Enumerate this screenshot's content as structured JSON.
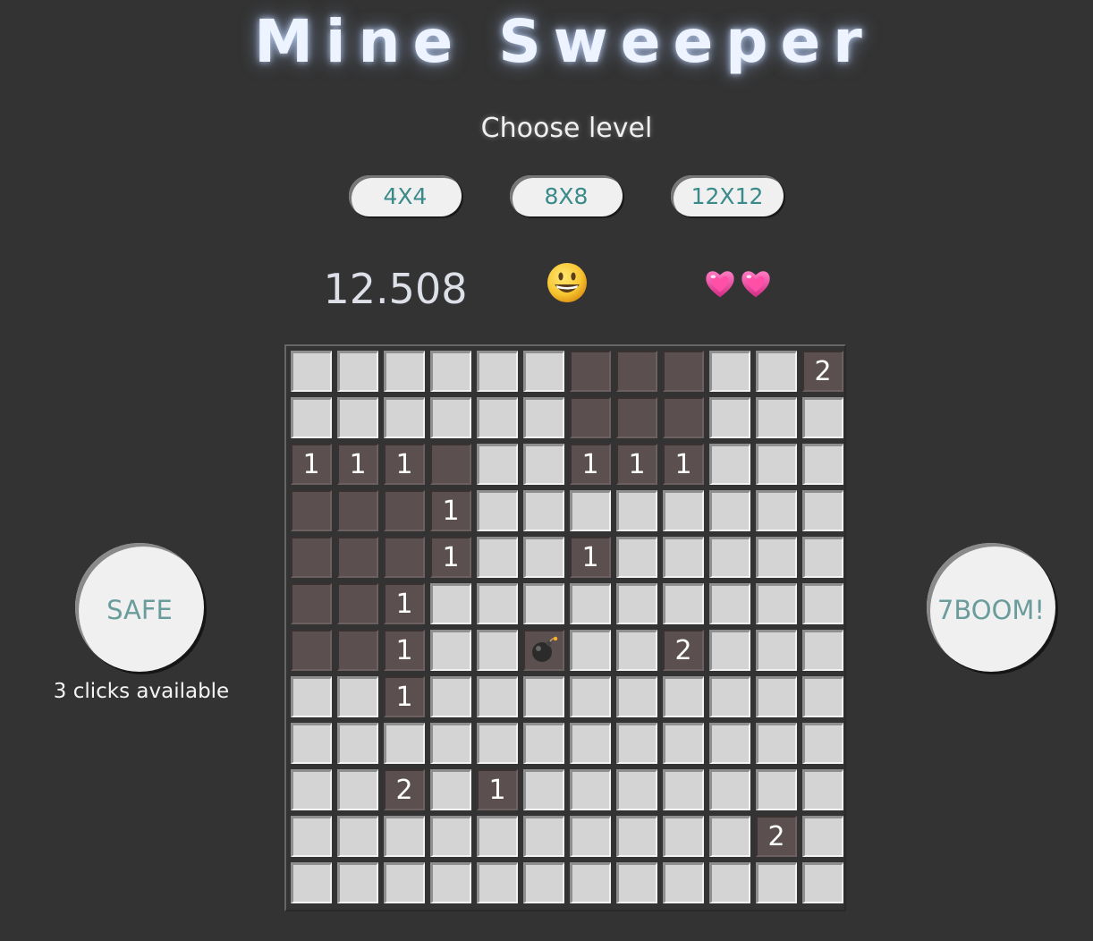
{
  "title": "Mine Sweeper",
  "subtitle": "Choose level",
  "levels": [
    "4X4",
    "8X8",
    "12X12"
  ],
  "status": {
    "timer": "12.508",
    "smiley_icon": "grinning-face",
    "lives": 2,
    "life_icon": "pink-heart"
  },
  "board": {
    "size": 12,
    "rows": [
      [
        "",
        "",
        "",
        "",
        "",
        "",
        "o",
        "o",
        "o",
        "",
        "",
        "2"
      ],
      [
        "",
        "",
        "",
        "",
        "",
        "",
        "o",
        "o",
        "o",
        "",
        "",
        ""
      ],
      [
        "1",
        "1",
        "1",
        "o",
        "",
        "",
        "1",
        "1",
        "1",
        "",
        "",
        ""
      ],
      [
        "o",
        "o",
        "o",
        "1",
        "",
        "",
        "",
        "",
        "",
        "",
        "",
        ""
      ],
      [
        "o",
        "o",
        "o",
        "1",
        "",
        "",
        "1",
        "",
        "",
        "",
        "",
        ""
      ],
      [
        "o",
        "o",
        "1",
        "",
        "",
        "",
        "",
        "",
        "",
        "",
        "",
        ""
      ],
      [
        "o",
        "o",
        "1",
        "",
        "",
        "*",
        "",
        "",
        "2",
        "",
        "",
        ""
      ],
      [
        "",
        "",
        "1",
        "",
        "",
        "",
        "",
        "",
        "",
        "",
        "",
        ""
      ],
      [
        "",
        "",
        "",
        "",
        "",
        "",
        "",
        "",
        "",
        "",
        "",
        ""
      ],
      [
        "",
        "",
        "2",
        "",
        "1",
        "",
        "",
        "",
        "",
        "",
        "",
        ""
      ],
      [
        "",
        "",
        "",
        "",
        "",
        "",
        "",
        "",
        "",
        "",
        "2",
        ""
      ],
      [
        "",
        "",
        "",
        "",
        "",
        "",
        "",
        "",
        "",
        "",
        "",
        ""
      ]
    ],
    "legend": {
      "": "hidden",
      "o": "open-empty",
      "*": "mine"
    }
  },
  "safe": {
    "label": "SAFE",
    "clicks_text": "3 clicks available"
  },
  "boom": {
    "label": "7BOOM!"
  },
  "colors": {
    "background": "#333333",
    "hidden_cell": "#d4d4d4",
    "open_cell": "#5b4f4f",
    "button_text": "#3a8a8a"
  }
}
